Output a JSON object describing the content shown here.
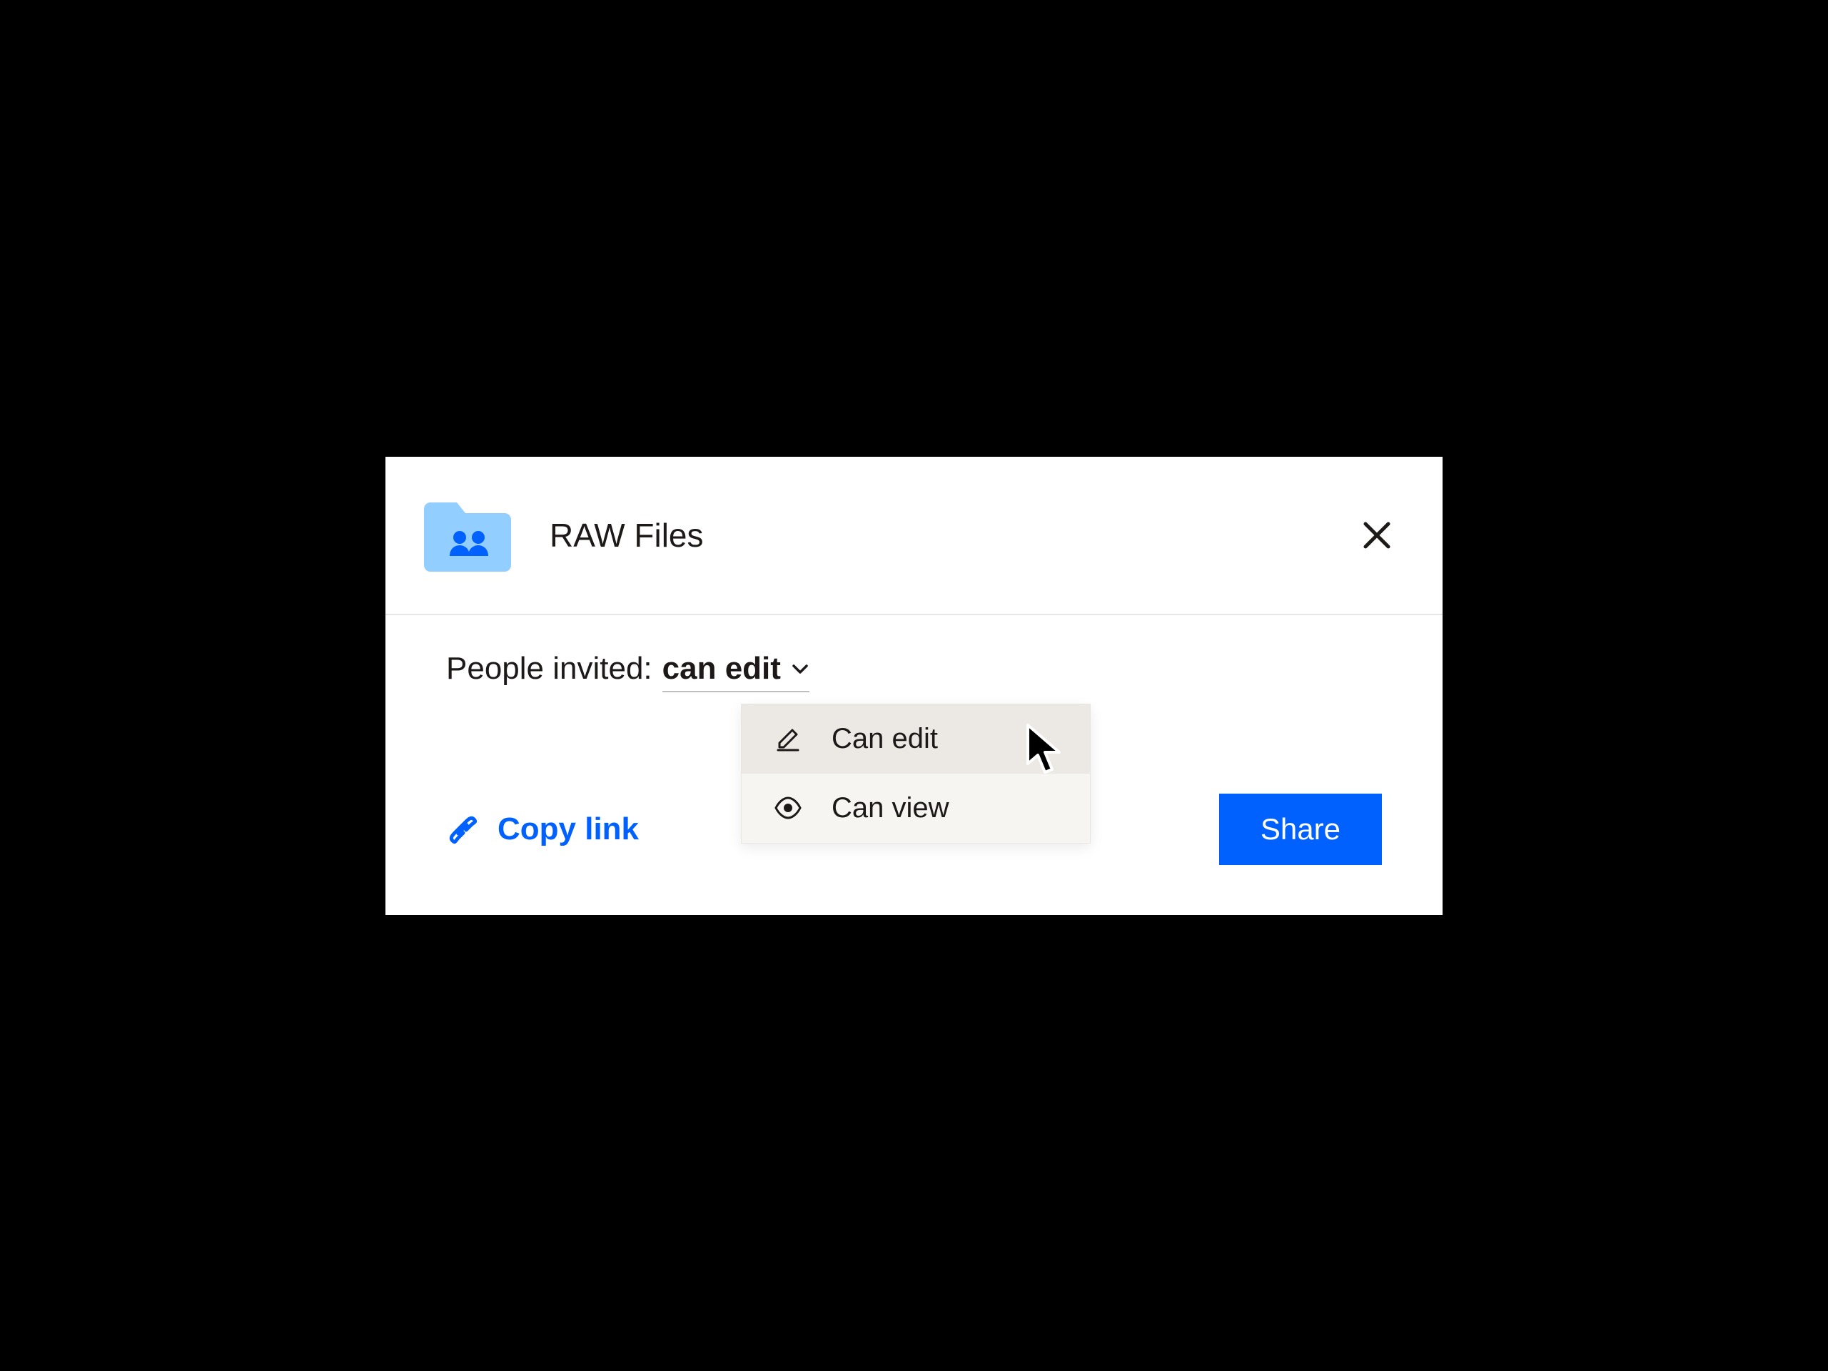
{
  "header": {
    "folder_name": "RAW Files"
  },
  "invite": {
    "label": "People invited:",
    "selected": "can edit"
  },
  "dropdown": {
    "options": [
      {
        "icon": "pencil",
        "label": "Can edit"
      },
      {
        "icon": "eye",
        "label": "Can view"
      }
    ]
  },
  "actions": {
    "copy_link": "Copy link",
    "share": "Share"
  },
  "colors": {
    "accent": "#0061fe",
    "folder": "#92ceff"
  }
}
